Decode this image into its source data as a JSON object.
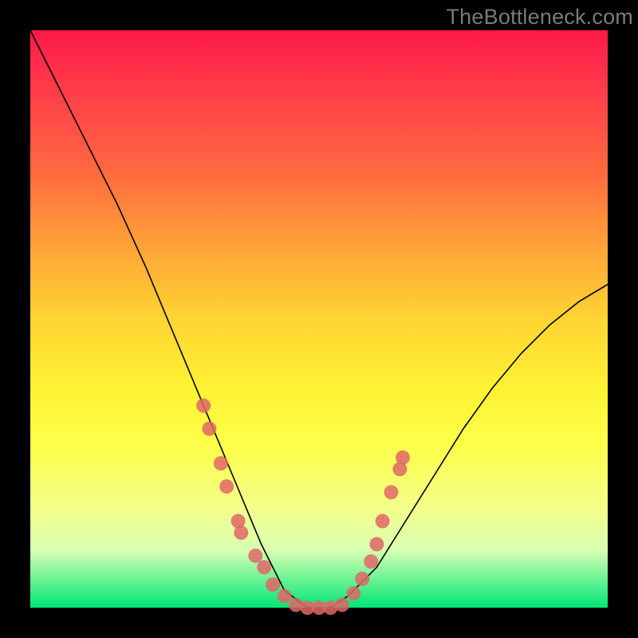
{
  "watermark": "TheBottleneck.com",
  "chart_data": {
    "type": "line",
    "title": "",
    "xlabel": "",
    "ylabel": "",
    "xlim": [
      0,
      100
    ],
    "ylim": [
      0,
      100
    ],
    "series": [
      {
        "name": "curve",
        "x": [
          0,
          5,
          10,
          15,
          20,
          25,
          30,
          35,
          40,
          44,
          48,
          50,
          52,
          55,
          60,
          65,
          70,
          75,
          80,
          85,
          90,
          95,
          100
        ],
        "y": [
          100,
          90,
          80,
          70,
          59,
          47,
          35,
          23,
          11,
          3,
          0,
          0,
          0,
          2,
          7,
          15,
          23,
          31,
          38,
          44,
          49,
          53,
          56
        ]
      }
    ],
    "points": [
      {
        "x": 30,
        "y": 35
      },
      {
        "x": 31,
        "y": 31
      },
      {
        "x": 33,
        "y": 25
      },
      {
        "x": 34,
        "y": 21
      },
      {
        "x": 36,
        "y": 15
      },
      {
        "x": 36.5,
        "y": 13
      },
      {
        "x": 39,
        "y": 9
      },
      {
        "x": 40.5,
        "y": 7
      },
      {
        "x": 42,
        "y": 4
      },
      {
        "x": 44,
        "y": 2
      },
      {
        "x": 46,
        "y": 0.5
      },
      {
        "x": 48,
        "y": 0
      },
      {
        "x": 50,
        "y": 0
      },
      {
        "x": 52,
        "y": 0
      },
      {
        "x": 54,
        "y": 0.5
      },
      {
        "x": 56,
        "y": 2.5
      },
      {
        "x": 57.5,
        "y": 5
      },
      {
        "x": 59,
        "y": 8
      },
      {
        "x": 60,
        "y": 11
      },
      {
        "x": 61,
        "y": 15
      },
      {
        "x": 62.5,
        "y": 20
      },
      {
        "x": 64,
        "y": 24
      },
      {
        "x": 64.5,
        "y": 26
      }
    ],
    "point_color": "#e06666",
    "point_radius": 9
  }
}
